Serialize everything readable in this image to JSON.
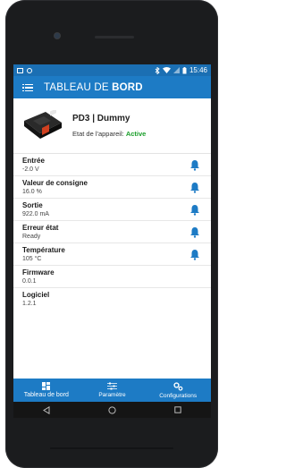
{
  "status_bar": {
    "time": "15:46",
    "icons": [
      "image-icon",
      "circle-icon",
      "bluetooth-icon",
      "wifi-icon",
      "signal-icon",
      "battery-icon"
    ]
  },
  "app_bar": {
    "title_regular": "TABLEAU DE ",
    "title_bold": "BORD",
    "menu_icon": "menu-icon"
  },
  "device": {
    "name": "PD3 | Dummy",
    "state_label": "Etat de l'appareil: ",
    "state_value": "Active",
    "state_color": "#1a9e2a"
  },
  "rows": [
    {
      "label": "Entrée",
      "value": "-2.0 V",
      "bell": true
    },
    {
      "label": "Valeur de consigne",
      "value": "16.0 %",
      "bell": true
    },
    {
      "label": "Sortie",
      "value": "922.0 mA",
      "bell": true
    },
    {
      "label": "Erreur état",
      "value": "Ready",
      "bell": true
    },
    {
      "label": "Température",
      "value": "105 °C",
      "bell": true
    },
    {
      "label": "Firmware",
      "value": "0.0.1",
      "bell": false
    },
    {
      "label": "Logiciel",
      "value": "1.2.1",
      "bell": false
    }
  ],
  "bottom_nav": [
    {
      "label": "Tableau de bord",
      "icon": "dashboard-icon"
    },
    {
      "label": "Paramètre",
      "icon": "sliders-icon"
    },
    {
      "label": "Configurations",
      "icon": "gears-icon"
    }
  ],
  "colors": {
    "primary": "#1d7bc5",
    "status_bar": "#1b6fb3",
    "bell": "#1d7bc5",
    "active": "#1a9e2a"
  }
}
